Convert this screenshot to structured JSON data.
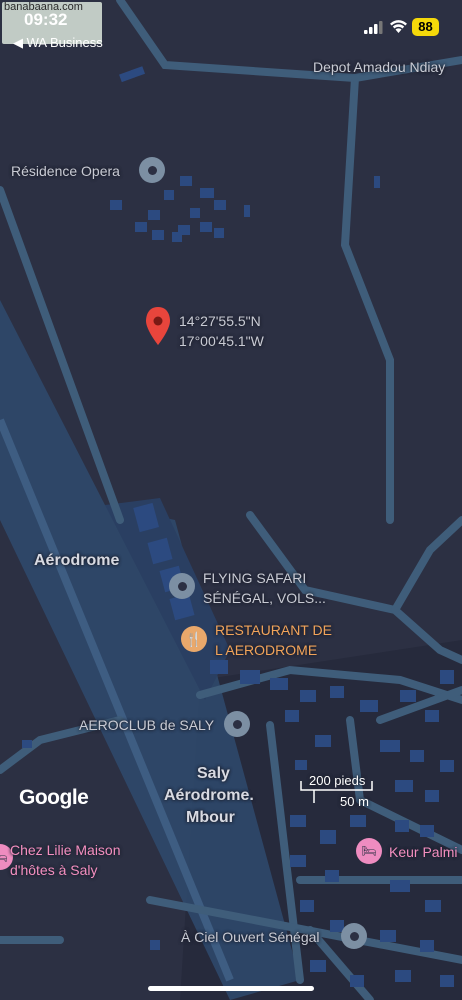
{
  "status_bar": {
    "time": "09:32",
    "back_label": "◀ WA Business",
    "battery": "88",
    "watermark": "banabaana.com"
  },
  "map": {
    "pin": {
      "lat": "14°27'55.5\"N",
      "lon": "17°00'45.1\"W",
      "color": "#e8453c"
    },
    "labels": {
      "depot": "Depot Amadou Ndiay",
      "residence": "Résidence Opera",
      "aerodrome": "Aérodrome",
      "flying_safari_1": "FLYING SAFARI",
      "flying_safari_2": "SÉNÉGAL, VOLS...",
      "restaurant_1": "RESTAURANT DE",
      "restaurant_2": "L AERODROME",
      "aeroclub": "AEROCLUB de SALY",
      "saly_1": "Saly",
      "saly_2": "Aérodrome.",
      "saly_3": "Mbour",
      "chez_lilie_1": "Chez Lilie Maison",
      "chez_lilie_2": "d'hôtes à Saly",
      "keur_palmi": "Keur Palmi",
      "ciel_ouvert": "À Ciel Ouvert Sénégal"
    },
    "icons": {
      "restaurant": "fork-knife-icon",
      "hotel": "bed-icon",
      "poi": "place-icon"
    },
    "colors": {
      "background": "#2c3043",
      "road": "#3f5d7a",
      "runway": "#2f4a6d",
      "building": "#2c4a80"
    }
  },
  "scale": {
    "feet": "200 pieds",
    "meters": "50 m"
  },
  "branding": {
    "google": "Google"
  }
}
